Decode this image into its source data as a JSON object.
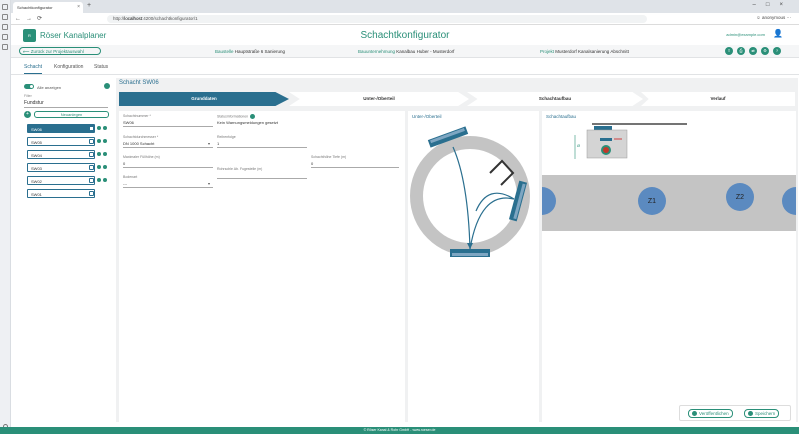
{
  "browser": {
    "tab_title": "Schachtkonfigurator",
    "url_host": "localhost",
    "url_path": ":4200/schachtkonfigurator/1",
    "user": "anonymous"
  },
  "app": {
    "name": "Röser Kanalplaner",
    "page_title": "Schachtkonfigurator",
    "email": "admin@example.com",
    "accent": "#2a8f78",
    "primary": "#2a6f8f"
  },
  "infobar": {
    "back_label": "Zurück zur Projektauswahl",
    "items": [
      {
        "key": "Baustelle",
        "value": "Hauptstraße 6 Sanierung"
      },
      {
        "key": "Bauunternehmung",
        "value": "Kanalbau Huber - Musterdorf"
      },
      {
        "key": "Projekt",
        "value": "Musterdorf Kanalsanierung Abschnitt"
      }
    ]
  },
  "main_tabs": [
    "Schacht",
    "Konfiguration",
    "Status"
  ],
  "sidebar": {
    "filter_label": "Alle anzeigen",
    "search_label": "Filter",
    "search_value": "Fundstur",
    "add_label": "Neuanlegen",
    "shafts": [
      {
        "name": "SW06",
        "selected": true
      },
      {
        "name": "SW05",
        "selected": false
      },
      {
        "name": "SW04",
        "selected": false
      },
      {
        "name": "SW03",
        "selected": false
      },
      {
        "name": "SW02",
        "selected": false
      },
      {
        "name": "SW01",
        "selected": false
      }
    ]
  },
  "section_title": "Schacht SW06",
  "steps": [
    "Grunddaten",
    "Unter-/Oberteil",
    "Schachtaufbau",
    "Verlauf"
  ],
  "form": {
    "schacht_label": "Schachtnummer *",
    "schacht_value": "SW06",
    "status_label": "Statusinformationen",
    "status_value": "Kein Warnungsmeldungen gesetzt",
    "durchmesser_label": "Schachtdurchmesser *",
    "durchmesser_value": "DN 1000 Schacht",
    "reihenfolge_label": "Reihenfolge",
    "reihenfolge_value": "1",
    "max_fuell_label": "Maximaler Füllhöhe (m)",
    "max_fuell_value": "0",
    "rohr_label": "Rohrsohle Ab. Fugestelle (m)",
    "rohr_value": "",
    "hoehe_label": "Schachthöhe Tiefe (m)",
    "hoehe_value": "0",
    "boden_label": "Bodenart",
    "boden_value": "---"
  },
  "panel_titles": {
    "unter": "Unter-/Oberteil",
    "aufbau": "Schachtaufbau"
  },
  "rings": [
    "Z1",
    "Z2"
  ],
  "actions": {
    "publish": "Veröffentlichen",
    "save": "Speichern"
  },
  "footer": "© Röser Kanal & Rohr GmbH - www.roeser.de"
}
